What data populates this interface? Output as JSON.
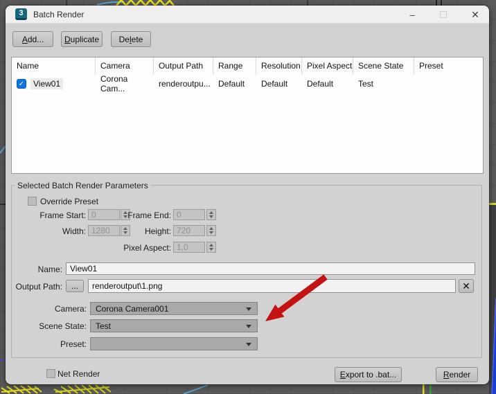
{
  "window": {
    "title": "Batch Render",
    "app_icon_glyph": "3",
    "minimize_glyph": "–",
    "close_glyph": "✕"
  },
  "toolbar": {
    "add_label": "Add...",
    "duplicate_label": "Duplicate",
    "delete_label": "Delete"
  },
  "table": {
    "columns": [
      "Name",
      "Camera",
      "Output Path",
      "Range",
      "Resolution",
      "Pixel Aspect",
      "Scene State",
      "Preset"
    ],
    "row": {
      "checked": true,
      "check_glyph": "✓",
      "name": "View01",
      "camera": "Corona Cam...",
      "output_path": "renderoutpu...",
      "range": "Default",
      "resolution": "Default",
      "pixel_aspect": "Default",
      "scene_state": "Test",
      "preset": ""
    }
  },
  "params": {
    "group_label": "Selected Batch Render Parameters",
    "override_preset": {
      "label": "Override Preset",
      "checked": false
    },
    "frame_start": {
      "label": "Frame Start:",
      "value": "0",
      "enabled": false
    },
    "frame_end": {
      "label": "Frame End:",
      "value": "0",
      "enabled": false
    },
    "width": {
      "label": "Width:",
      "value": "1280",
      "enabled": false
    },
    "height": {
      "label": "Height:",
      "value": "720",
      "enabled": false
    },
    "pixel_aspect": {
      "label": "Pixel Aspect:",
      "value": "1,0",
      "enabled": false
    },
    "name": {
      "label": "Name:",
      "value": "View01"
    },
    "output_path": {
      "label": "Output Path:",
      "browse_label": "...",
      "value": "renderoutput\\1.png",
      "clear_glyph": "✕"
    },
    "camera": {
      "label": "Camera:",
      "value": "Corona Camera001"
    },
    "scene_state": {
      "label": "Scene State:",
      "value": "Test"
    },
    "preset": {
      "label": "Preset:",
      "value": ""
    }
  },
  "footer": {
    "net_render": {
      "label": "Net Render",
      "checked": false
    },
    "export_label": "Export to .bat...",
    "render_label": "Render"
  },
  "colors": {
    "annotation_arrow": "#c41212",
    "checkbox_accent": "#1273de",
    "dialog_bg": "#d2d2d2",
    "viewport_bg": "#5b5b5b"
  }
}
